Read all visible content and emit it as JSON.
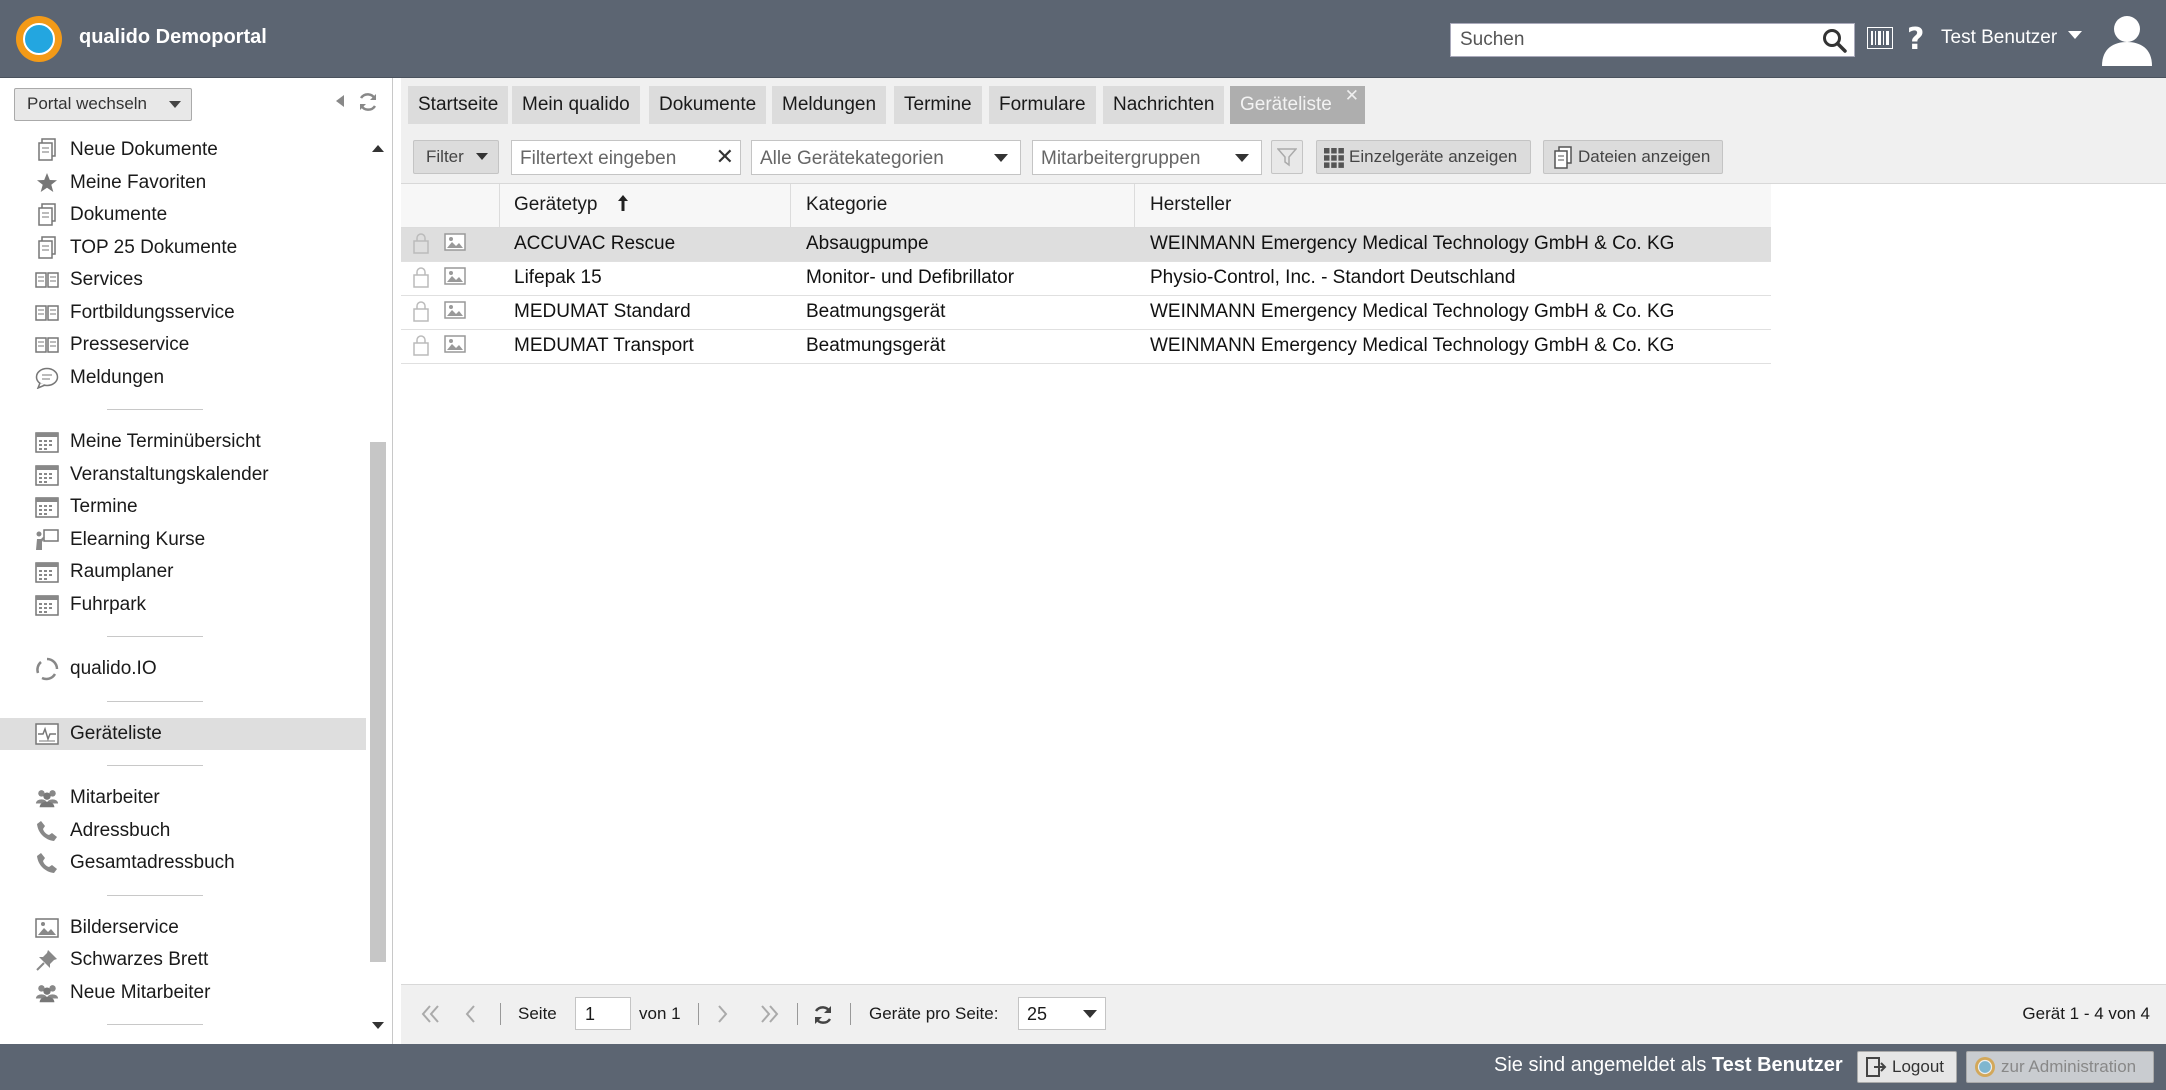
{
  "header": {
    "app_title": "qualido Demoportal",
    "search_placeholder": "Suchen",
    "user_name": "Test Benutzer"
  },
  "sidebar": {
    "portal_switch": "Portal wechseln",
    "items": [
      {
        "label": "Neue Dokumente",
        "icon": "document-icon"
      },
      {
        "label": "Meine Favoriten",
        "icon": "star-icon"
      },
      {
        "label": "Dokumente",
        "icon": "document-icon"
      },
      {
        "label": "TOP 25 Dokumente",
        "icon": "document-icon"
      },
      {
        "label": "Services",
        "icon": "book-icon"
      },
      {
        "label": "Fortbildungsservice",
        "icon": "book-icon"
      },
      {
        "label": "Presseservice",
        "icon": "book-icon"
      },
      {
        "label": "Meldungen",
        "icon": "speech-bubble-icon"
      },
      {
        "label": "Meine Terminübersicht",
        "icon": "calendar-icon"
      },
      {
        "label": "Veranstaltungskalender",
        "icon": "calendar-icon"
      },
      {
        "label": "Termine",
        "icon": "calendar-icon"
      },
      {
        "label": "Elearning Kurse",
        "icon": "presentation-icon"
      },
      {
        "label": "Raumplaner",
        "icon": "calendar-icon"
      },
      {
        "label": "Fuhrpark",
        "icon": "calendar-icon"
      },
      {
        "label": "qualido.IO",
        "icon": "cycle-icon"
      },
      {
        "label": "Geräteliste",
        "icon": "device-icon"
      },
      {
        "label": "Mitarbeiter",
        "icon": "people-icon"
      },
      {
        "label": "Adressbuch",
        "icon": "phone-icon"
      },
      {
        "label": "Gesamtadressbuch",
        "icon": "phone-icon"
      },
      {
        "label": "Bilderservice",
        "icon": "image-icon"
      },
      {
        "label": "Schwarzes Brett",
        "icon": "pin-icon"
      },
      {
        "label": "Neue Mitarbeiter",
        "icon": "people-icon"
      }
    ]
  },
  "tabs": [
    {
      "label": "Startseite"
    },
    {
      "label": "Mein qualido"
    },
    {
      "label": "Dokumente"
    },
    {
      "label": "Meldungen"
    },
    {
      "label": "Termine"
    },
    {
      "label": "Formulare"
    },
    {
      "label": "Nachrichten"
    },
    {
      "label": "Geräteliste",
      "active": true
    }
  ],
  "toolbar": {
    "filter_label": "Filter",
    "filter_text_placeholder": "Filtertext eingeben",
    "category_select": "Alle Gerätekategorien",
    "employee_group_select": "Mitarbeitergruppen",
    "single_devices_button": "Einzelgeräte anzeigen",
    "files_button": "Dateien anzeigen"
  },
  "table": {
    "columns": [
      "Gerätetyp",
      "Kategorie",
      "Hersteller"
    ],
    "sort_column": "Gerätetyp",
    "rows": [
      {
        "type": "ACCUVAC Rescue",
        "category": "Absaugpumpe",
        "manufacturer": "WEINMANN Emergency Medical Technology GmbH & Co. KG",
        "selected": true
      },
      {
        "type": "Lifepak 15",
        "category": "Monitor- und Defibrillator",
        "manufacturer": "Physio-Control, Inc. - Standort Deutschland"
      },
      {
        "type": "MEDUMAT Standard",
        "category": "Beatmungsgerät",
        "manufacturer": "WEINMANN Emergency Medical Technology GmbH & Co. KG"
      },
      {
        "type": "MEDUMAT Transport",
        "category": "Beatmungsgerät",
        "manufacturer": "WEINMANN Emergency Medical Technology GmbH & Co. KG"
      }
    ]
  },
  "pager": {
    "page_label": "Seite",
    "page_value": "1",
    "of_label": "von 1",
    "per_page_label": "Geräte pro Seite:",
    "per_page_value": "25",
    "summary": "Gerät 1 - 4 von 4"
  },
  "footer": {
    "logged_in_prefix": "Sie sind angemeldet als",
    "logged_in_user": "Test Benutzer",
    "logout_label": "Logout",
    "admin_label": "zur Administration"
  },
  "colors": {
    "header_bg": "#5c6572",
    "tab_active": "#aeaeae",
    "selected_row": "#dedede",
    "logo_outer": "#f39a17",
    "logo_inner": "#23a6e0"
  }
}
